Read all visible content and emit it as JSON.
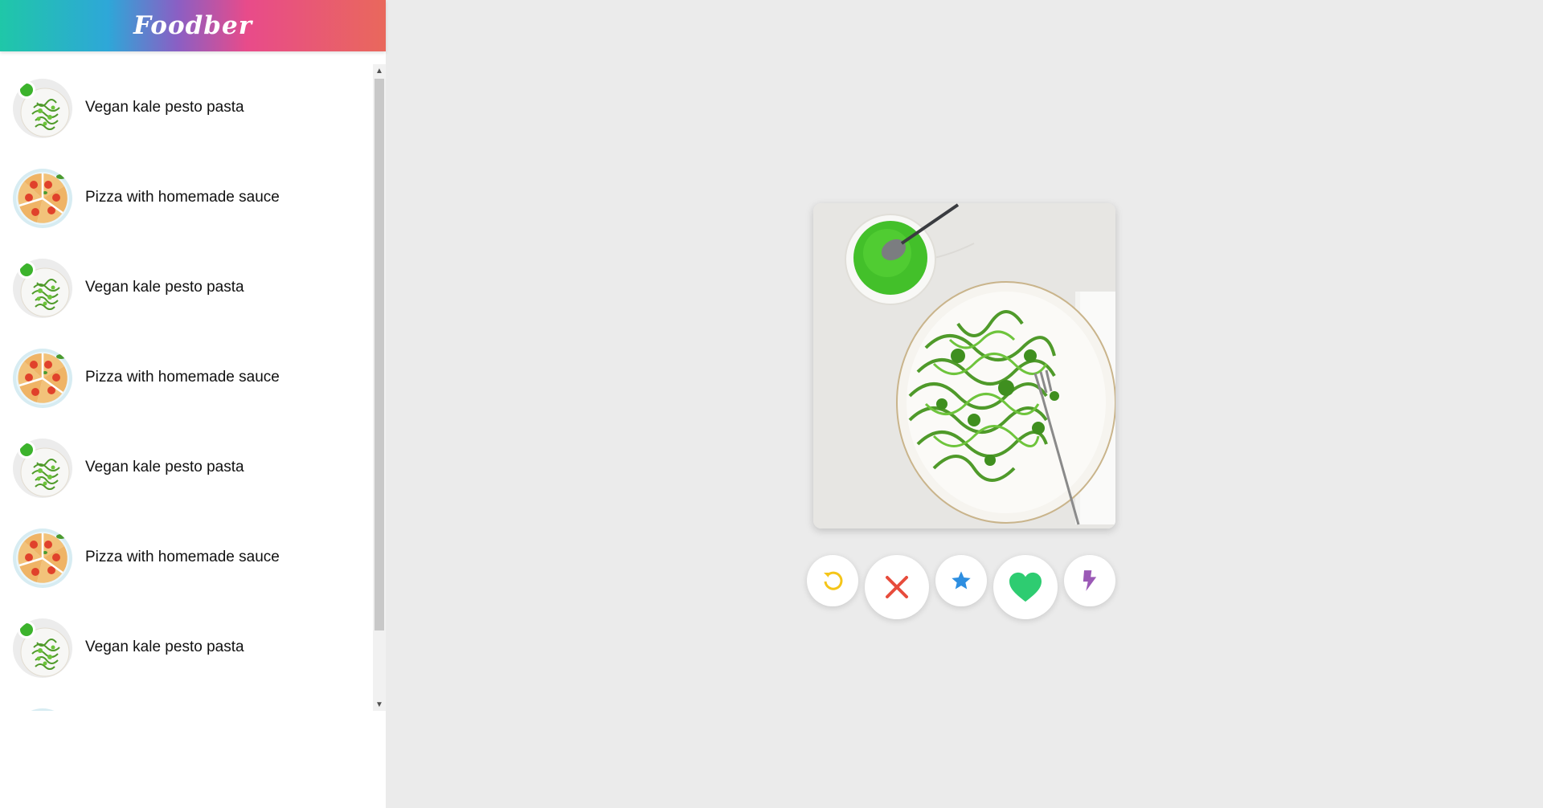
{
  "app": {
    "title": "Foodber"
  },
  "sidebar": {
    "items": [
      {
        "label": "Vegan kale pesto pasta",
        "thumbnail": "pesto-pasta"
      },
      {
        "label": "Pizza with homemade sauce",
        "thumbnail": "pizza"
      },
      {
        "label": "Vegan kale pesto pasta",
        "thumbnail": "pesto-pasta"
      },
      {
        "label": "Pizza with homemade sauce",
        "thumbnail": "pizza"
      },
      {
        "label": "Vegan kale pesto pasta",
        "thumbnail": "pesto-pasta"
      },
      {
        "label": "Pizza with homemade sauce",
        "thumbnail": "pizza"
      },
      {
        "label": "Vegan kale pesto pasta",
        "thumbnail": "pesto-pasta"
      },
      {
        "label": "",
        "thumbnail": "pizza"
      }
    ]
  },
  "card": {
    "image": "pesto-pasta"
  },
  "actions": [
    {
      "name": "rewind",
      "icon": "rewind-icon",
      "color": "#f5c518"
    },
    {
      "name": "nope",
      "icon": "close-icon",
      "color": "#e74c3c"
    },
    {
      "name": "super-like",
      "icon": "star-icon",
      "color": "#2d8ee0"
    },
    {
      "name": "like",
      "icon": "heart-icon",
      "color": "#2ecc71"
    },
    {
      "name": "boost",
      "icon": "lightning-icon",
      "color": "#9b59b6"
    }
  ],
  "colors": {
    "header_gradient": [
      "#1fc7a8",
      "#2ea7d8",
      "#e84b8a",
      "#e9685c"
    ],
    "background": "#ebebeb"
  }
}
